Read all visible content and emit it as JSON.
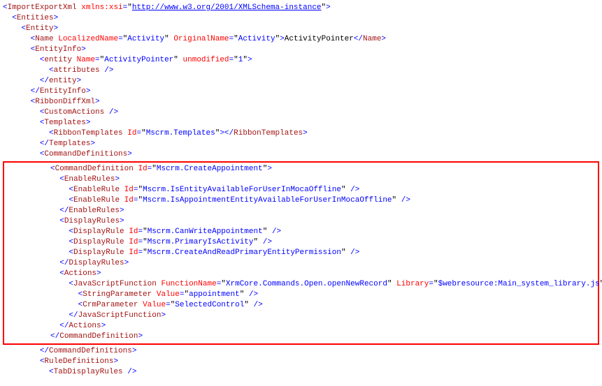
{
  "l0": {
    "t1": "ImportExportXml",
    "a1": "xmlns:xsi",
    "v1": "http://www.w3.org/2001/XMLSchema-instance"
  },
  "l1": {
    "t1": "Entities"
  },
  "l2": {
    "t1": "Entity"
  },
  "l3": {
    "t1": "Name",
    "a1": "LocalizedName",
    "v1": "Activity",
    "a2": "OriginalName",
    "v2": "Activity",
    "txt": "ActivityPointer",
    "t2": "Name"
  },
  "l4": {
    "t1": "EntityInfo"
  },
  "l5": {
    "t1": "entity",
    "a1": "Name",
    "v1": "ActivityPointer",
    "a2": "unmodified",
    "v2": "1"
  },
  "l6": {
    "t1": "attributes"
  },
  "l7": {
    "t1": "entity"
  },
  "l8": {
    "t1": "EntityInfo"
  },
  "l9": {
    "t1": "RibbonDiffXml"
  },
  "l10": {
    "t1": "CustomActions"
  },
  "l11": {
    "t1": "Templates"
  },
  "l12": {
    "t1": "RibbonTemplates",
    "a1": "Id",
    "v1": "Mscrm.Templates",
    "t2": "RibbonTemplates"
  },
  "l13": {
    "t1": "Templates"
  },
  "l14": {
    "t1": "CommandDefinitions"
  },
  "l15": {
    "t1": "CommandDefinition",
    "a1": "Id",
    "v1": "Mscrm.CreateAppointment"
  },
  "l16": {
    "t1": "EnableRules"
  },
  "l17": {
    "t1": "EnableRule",
    "a1": "Id",
    "v1": "Mscrm.IsEntityAvailableForUserInMocaOffline"
  },
  "l18": {
    "t1": "EnableRule",
    "a1": "Id",
    "v1": "Mscrm.IsAppointmentEntityAvailableForUserInMocaOffline"
  },
  "l19": {
    "t1": "EnableRules"
  },
  "l20": {
    "t1": "DisplayRules"
  },
  "l21": {
    "t1": "DisplayRule",
    "a1": "Id",
    "v1": "Mscrm.CanWriteAppointment"
  },
  "l22": {
    "t1": "DisplayRule",
    "a1": "Id",
    "v1": "Mscrm.PrimaryIsActivity"
  },
  "l23": {
    "t1": "DisplayRule",
    "a1": "Id",
    "v1": "Mscrm.CreateAndReadPrimaryEntityPermission"
  },
  "l24": {
    "t1": "DisplayRules"
  },
  "l25": {
    "t1": "Actions"
  },
  "l26": {
    "t1": "JavaScriptFunction",
    "a1": "FunctionName",
    "v1": "XrmCore.Commands.Open.openNewRecord",
    "a2": "Library",
    "v2": "$webresource:Main_system_library.js"
  },
  "l27": {
    "t1": "StringParameter",
    "a1": "Value",
    "v1": "appointment"
  },
  "l28": {
    "t1": "CrmParameter",
    "a1": "Value",
    "v1": "SelectedControl"
  },
  "l29": {
    "t1": "JavaScriptFunction"
  },
  "l30": {
    "t1": "Actions"
  },
  "l31": {
    "t1": "CommandDefinition"
  },
  "l32": {
    "t1": "CommandDefinitions"
  },
  "l33": {
    "t1": "RuleDefinitions"
  },
  "l34": {
    "t1": "TabDisplayRules"
  },
  "indent_unit": "  "
}
